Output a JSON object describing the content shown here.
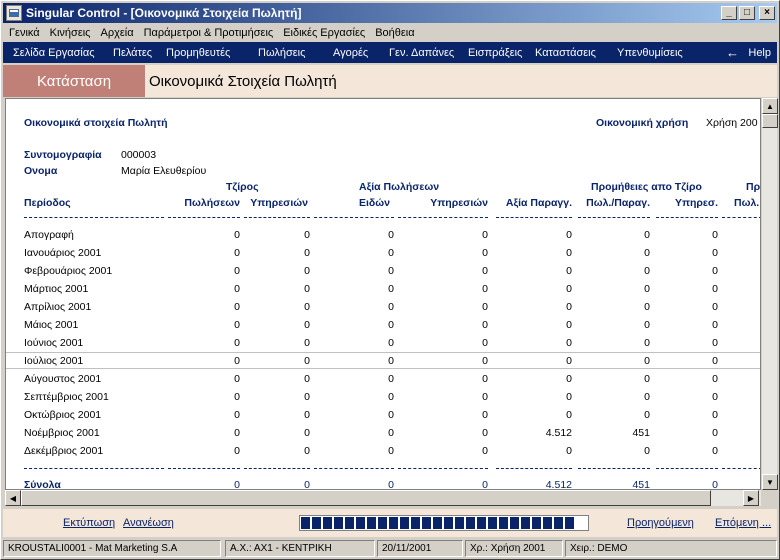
{
  "window": {
    "title": "Singular Control - [Οικονομικά Στοιχεία Πωλητή]",
    "controls": [
      "_",
      "□",
      "×"
    ]
  },
  "menu": [
    "Γενικά",
    "Κινήσεις",
    "Αρχεία",
    "Παράμετροι & Προτιμήσεις",
    "Ειδικές Εργασίες",
    "Βοήθεια"
  ],
  "nav": {
    "items": [
      "Σελίδα Εργασίας",
      "Πελάτες",
      "Προμηθευτές",
      "Πωλήσεις",
      "Αγορές",
      "Γεν. Δαπάνες",
      "Εισπράξεις",
      "Καταστάσεις",
      "Υπενθυμίσεις"
    ],
    "help": "Help"
  },
  "header": {
    "tab_label": "Κατάσταση",
    "page_title": "Οικονομικά Στοιχεία Πωλητή"
  },
  "report": {
    "title": "Οικονομικά στοιχεία Πωλητή",
    "fiscal_label": "Οικονομική χρήση",
    "fiscal_value": "Χρήση 200",
    "code_label": "Συντομογραφία",
    "code_value": "000003",
    "name_label": "Ονομα",
    "name_value": "Μαρία Ελευθερίου",
    "group_headers": {
      "turnover": "Τζίρος",
      "sales_value": "Αξία Πωλήσεων",
      "commissions": "Προμήθειες απο Τζίρο",
      "next_group": "Πρ"
    },
    "columns": [
      "Περίοδος",
      "Πωλήσεων",
      "Υπηρεσιών",
      "Ειδών",
      "Υπηρεσιών",
      "Αξία Παραγγ.",
      "Πωλ./Παραγ.",
      "Υπηρεσ.",
      "Πωλ."
    ],
    "rows": [
      {
        "period": "Απογραφή",
        "v": [
          "0",
          "0",
          "0",
          "0",
          "0",
          "0",
          "0"
        ]
      },
      {
        "period": "Ιανουάριος 2001",
        "v": [
          "0",
          "0",
          "0",
          "0",
          "0",
          "0",
          "0"
        ]
      },
      {
        "period": "Φεβρουάριος 2001",
        "v": [
          "0",
          "0",
          "0",
          "0",
          "0",
          "0",
          "0"
        ]
      },
      {
        "period": "Μάρτιος 2001",
        "v": [
          "0",
          "0",
          "0",
          "0",
          "0",
          "0",
          "0"
        ]
      },
      {
        "period": "Απρίλιος 2001",
        "v": [
          "0",
          "0",
          "0",
          "0",
          "0",
          "0",
          "0"
        ]
      },
      {
        "period": "Μάιος 2001",
        "v": [
          "0",
          "0",
          "0",
          "0",
          "0",
          "0",
          "0"
        ]
      },
      {
        "period": "Ιούνιος 2001",
        "v": [
          "0",
          "0",
          "0",
          "0",
          "0",
          "0",
          "0"
        ]
      },
      {
        "period": "Ιούλιος 2001",
        "v": [
          "0",
          "0",
          "0",
          "0",
          "0",
          "0",
          "0"
        ]
      },
      {
        "period": "Αύγουστος 2001",
        "v": [
          "0",
          "0",
          "0",
          "0",
          "0",
          "0",
          "0"
        ]
      },
      {
        "period": "Σεπτέμβριος 2001",
        "v": [
          "0",
          "0",
          "0",
          "0",
          "0",
          "0",
          "0"
        ]
      },
      {
        "period": "Οκτώβριος 2001",
        "v": [
          "0",
          "0",
          "0",
          "0",
          "0",
          "0",
          "0"
        ]
      },
      {
        "period": "Νοέμβριος 2001",
        "v": [
          "0",
          "0",
          "0",
          "0",
          "4.512",
          "451",
          "0"
        ]
      },
      {
        "period": "Δεκέμβριος 2001",
        "v": [
          "0",
          "0",
          "0",
          "0",
          "0",
          "0",
          "0"
        ]
      }
    ],
    "totals": {
      "label": "Σύνολα",
      "v": [
        "0",
        "0",
        "0",
        "0",
        "4.512",
        "451",
        "0"
      ]
    }
  },
  "bottom": {
    "print": "Εκτύπωση",
    "refresh": "Ανανέωση",
    "prev": "Προηγούμενη",
    "next": "Επόμενη ..."
  },
  "status": {
    "company": "KROUSTALI0001 - Mat Marketing S.A",
    "branch": "Α.Χ.: ΑΧ1 - ΚΕΝΤΡΙΚΗ",
    "date": "20/11/2001",
    "fiscal": "Χρ.: Χρήση 2001",
    "user": "Χειρ.: DEMO"
  }
}
